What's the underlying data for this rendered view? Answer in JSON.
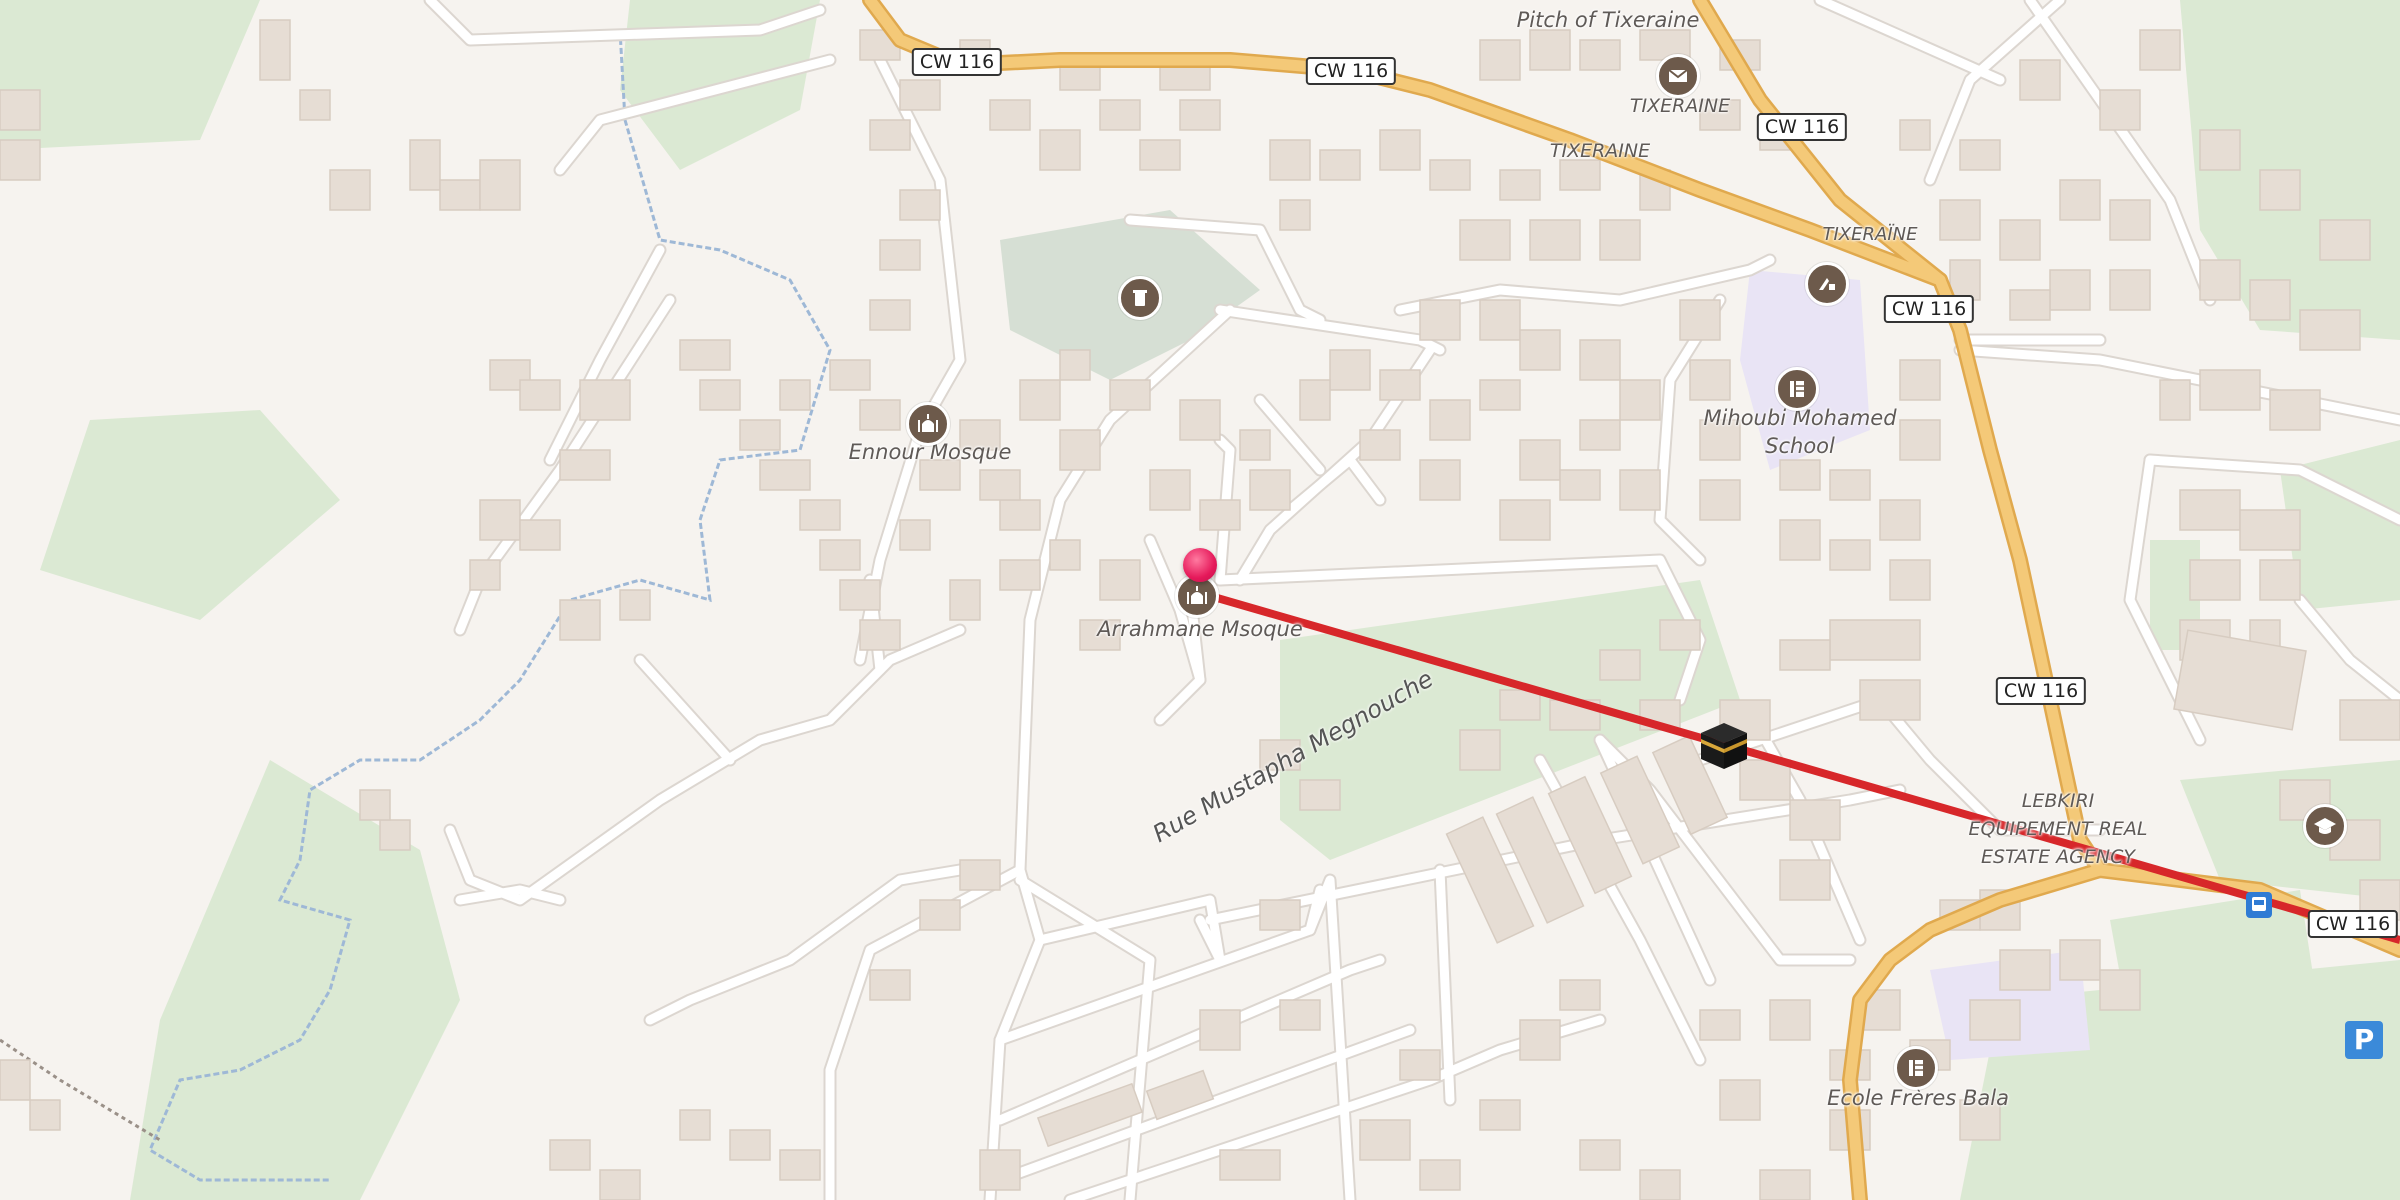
{
  "map": {
    "place_labels": [
      {
        "id": "pitch-of-tixeraine",
        "text": "Pitch of Tixeraine"
      },
      {
        "id": "tixeraine-post",
        "text": "TIXERAINE"
      },
      {
        "id": "tixeraine-road",
        "text": "TIXERAINE"
      },
      {
        "id": "tixeraine-east",
        "text": "TIXERAÏNE"
      },
      {
        "id": "ennour-mosque",
        "text": "Ennour Mosque"
      },
      {
        "id": "arrahmane-mosque",
        "text": "Arrahmane Msoque"
      },
      {
        "id": "mihoubi-school-1",
        "text": "Mihoubi Mohamed"
      },
      {
        "id": "mihoubi-school-2",
        "text": "School"
      },
      {
        "id": "lebkiri-1",
        "text": "LEBKIRI"
      },
      {
        "id": "lebkiri-2",
        "text": "EQUIPEMENT REAL"
      },
      {
        "id": "lebkiri-3",
        "text": "ESTATE AGENCY"
      },
      {
        "id": "ecole-freres-bala",
        "text": "Ecole Frères Bala"
      }
    ],
    "street_label": "Rue Mustapha Megnouche",
    "road_shields": [
      "CW 116",
      "CW 116",
      "CW 116",
      "CW 116",
      "CW 116",
      "CW 116"
    ],
    "parking_label": "P",
    "poi_icons": [
      "cemetery-icon",
      "mosque-icon",
      "mosque-icon",
      "post-office-icon",
      "school-icon",
      "school-icon",
      "school-icon",
      "education-icon",
      "bus-stop-icon",
      "parking-icon"
    ],
    "markers": {
      "location_pin": "location-pin",
      "qibla_kaaba": "kaaba-icon"
    },
    "colors": {
      "background": "#f6f3ef",
      "building": "#e6ddd4",
      "road_major": "#f4c978",
      "road_edge": "#e0a94e",
      "road_minor": "#ffffff",
      "green": "#d9ecd3",
      "water": "#9eb8d6",
      "school_area": "#e9e4f5",
      "qibla_line": "#d7272a",
      "pin": "#e5195a"
    }
  }
}
